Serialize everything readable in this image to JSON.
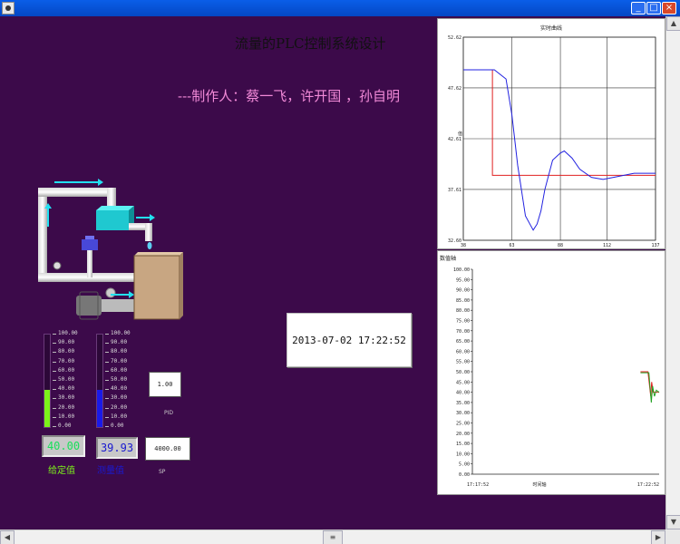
{
  "window": {
    "minimize": "_",
    "maximize": "□",
    "close": "×"
  },
  "header": {
    "title": "流量的PLC控制系统设计",
    "authors": "---制作人：蔡一飞，许开国 ，孙自明"
  },
  "datetime": "2013-07-02  17:22:52",
  "left_gauge": {
    "ticks": [
      "100.00",
      "90.00",
      "80.00",
      "70.00",
      "60.00",
      "50.00",
      "40.00",
      "30.00",
      "20.00",
      "10.00",
      "0.00"
    ],
    "fill_fraction": 0.4,
    "fill_color": "#7cf21a",
    "display": "40.00",
    "display_color": "#19e05a",
    "label": "给定值",
    "label_color": "#7cf21a"
  },
  "right_gauge": {
    "ticks": [
      "100.00",
      "90.00",
      "80.00",
      "70.00",
      "60.00",
      "50.00",
      "40.00",
      "30.00",
      "20.00",
      "10.00",
      "0.00"
    ],
    "fill_fraction": 0.4,
    "fill_color": "#1a1ae8",
    "display": "39.93",
    "display_color": "#1a1ad0",
    "label": "测量值",
    "label_color": "#1a1ad0"
  },
  "small_boxes": [
    {
      "value": "1.00",
      "label": "PID"
    },
    {
      "value": "4000.00",
      "label": "SP"
    }
  ],
  "realtime_chart": {
    "title": "实时曲线",
    "ylabel": "值",
    "y_ticks": [
      "52.62",
      "47.62",
      "42.61",
      "37.61",
      "32.60"
    ],
    "x_ticks": [
      "38",
      "63",
      "88",
      "112",
      "137"
    ]
  },
  "history_chart": {
    "title": "数值轴",
    "y_ticks": [
      "100.00",
      "95.00",
      "90.00",
      "85.00",
      "80.00",
      "75.00",
      "70.00",
      "65.00",
      "60.00",
      "55.00",
      "50.00",
      "45.00",
      "40.00",
      "35.00",
      "30.00",
      "25.00",
      "20.00",
      "15.00",
      "10.00",
      "5.00",
      "0.00"
    ],
    "x_start": "17:17:52",
    "x_end": "17:22:52",
    "xlabel": "时间轴"
  },
  "chart_data": [
    {
      "type": "line",
      "title": "实时曲线",
      "ylim": [
        32.6,
        52.62
      ],
      "xlim": [
        38,
        137
      ],
      "series": [
        {
          "color": "#e02020",
          "x": [
            38,
            53,
            53,
            54,
            137
          ],
          "y": [
            49.4,
            49.4,
            39.0,
            39.0,
            39.0
          ]
        },
        {
          "color": "#2020e0",
          "x": [
            38,
            54,
            60,
            63,
            66,
            70,
            74,
            76,
            78,
            80,
            84,
            88,
            90,
            94,
            98,
            104,
            110,
            118,
            126,
            137
          ],
          "y": [
            49.4,
            49.4,
            48.5,
            45,
            40,
            35,
            33.6,
            34.2,
            35.5,
            37.6,
            40.5,
            41.2,
            41.4,
            40.7,
            39.6,
            38.8,
            38.6,
            38.9,
            39.2,
            39.2
          ]
        }
      ]
    },
    {
      "type": "line",
      "title": "数值轴",
      "ylim": [
        0,
        100
      ],
      "xlim": [
        0,
        100
      ],
      "series": [
        {
          "color": "#e02020",
          "x": [
            90,
            94,
            95.5,
            96,
            96.8,
            98,
            100
          ],
          "y": [
            50,
            50,
            38,
            45,
            40,
            40,
            40
          ]
        },
        {
          "color": "#20a020",
          "x": [
            90,
            94.5,
            95.8,
            96.5,
            97.5,
            98.5,
            100
          ],
          "y": [
            49.5,
            49.5,
            35,
            43,
            38,
            41,
            40
          ]
        }
      ]
    }
  ]
}
